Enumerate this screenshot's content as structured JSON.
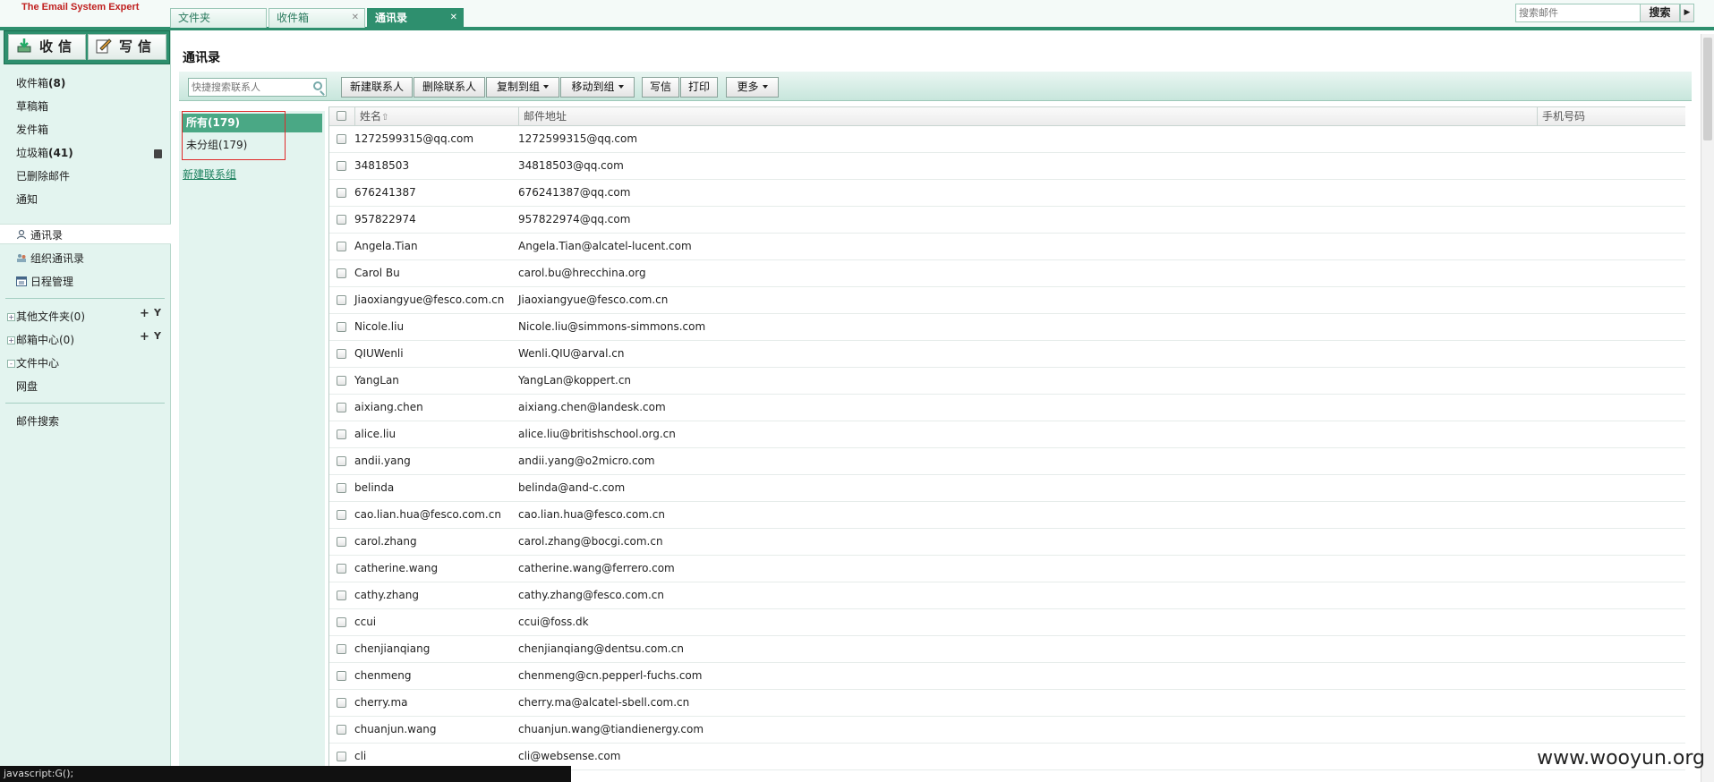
{
  "brand": "The Email System Expert",
  "tabs": [
    {
      "label": "文件夹",
      "closable": false,
      "active": false
    },
    {
      "label": "收件箱",
      "closable": true,
      "active": false
    },
    {
      "label": "通讯录",
      "closable": true,
      "active": true
    }
  ],
  "search": {
    "placeholder": "搜索邮件",
    "button": "搜索",
    "more": "▶"
  },
  "sidebar": {
    "receive": "收信",
    "compose": "写信",
    "folders": [
      {
        "label": "收件箱",
        "count": "(8)"
      },
      {
        "label": "草稿箱",
        "count": ""
      },
      {
        "label": "发件箱",
        "count": ""
      },
      {
        "label": "垃圾箱",
        "count": "(41)"
      },
      {
        "label": "已删除邮件",
        "count": ""
      },
      {
        "label": "通知",
        "count": ""
      }
    ],
    "apps": [
      {
        "label": "通讯录",
        "icon": "person-icon",
        "selected": true
      },
      {
        "label": "组织通讯录",
        "icon": "org-icon",
        "selected": false
      },
      {
        "label": "日程管理",
        "icon": "calendar-icon",
        "selected": false
      }
    ],
    "tree": [
      {
        "label": "其他文件夹(0)",
        "toggle": "+"
      },
      {
        "label": "邮箱中心(0)",
        "toggle": "+"
      },
      {
        "label": "文件中心",
        "toggle": "-"
      }
    ],
    "netdisk": "网盘",
    "mail_search": "邮件搜索"
  },
  "main": {
    "title": "通讯录",
    "contact_search_placeholder": "快捷搜索联系人",
    "toolbar": [
      {
        "label": "新建联系人",
        "dropdown": false
      },
      {
        "label": "删除联系人",
        "dropdown": false
      },
      {
        "label": "复制到组",
        "dropdown": true
      },
      {
        "label": "移动到组",
        "dropdown": true
      },
      {
        "label": "写信",
        "dropdown": false
      },
      {
        "label": "打印",
        "dropdown": false
      },
      {
        "label": "更多",
        "dropdown": true
      }
    ],
    "groups": [
      {
        "label": "所有",
        "count": "(179)",
        "selected": true
      },
      {
        "label": "未分组",
        "count": "(179)",
        "selected": false
      }
    ],
    "new_group": "新建联系组",
    "columns": {
      "name": "姓名",
      "sort_indicator": "⇧",
      "email": "邮件地址",
      "phone": "手机号码"
    },
    "contacts": [
      {
        "name": "1272599315@qq.com",
        "email": "1272599315@qq.com"
      },
      {
        "name": "34818503",
        "email": "34818503@qq.com"
      },
      {
        "name": "676241387",
        "email": "676241387@qq.com"
      },
      {
        "name": "957822974",
        "email": "957822974@qq.com"
      },
      {
        "name": "Angela.Tian",
        "email": "Angela.Tian@alcatel-lucent.com"
      },
      {
        "name": "Carol Bu",
        "email": "carol.bu@hrecchina.org"
      },
      {
        "name": "Jiaoxiangyue@fesco.com.cn",
        "email": "Jiaoxiangyue@fesco.com.cn"
      },
      {
        "name": "Nicole.liu",
        "email": "Nicole.liu@simmons-simmons.com"
      },
      {
        "name": "QIUWenli",
        "email": "Wenli.QIU@arval.cn"
      },
      {
        "name": "YangLan",
        "email": "YangLan@koppert.cn"
      },
      {
        "name": "aixiang.chen",
        "email": "aixiang.chen@landesk.com"
      },
      {
        "name": "alice.liu",
        "email": "alice.liu@britishschool.org.cn"
      },
      {
        "name": "andii.yang",
        "email": "andii.yang@o2micro.com"
      },
      {
        "name": "belinda",
        "email": "belinda@and-c.com"
      },
      {
        "name": "cao.lian.hua@fesco.com.cn",
        "email": "cao.lian.hua@fesco.com.cn"
      },
      {
        "name": "carol.zhang",
        "email": "carol.zhang@bocgi.com.cn"
      },
      {
        "name": "catherine.wang",
        "email": "catherine.wang@ferrero.com"
      },
      {
        "name": "cathy.zhang",
        "email": "cathy.zhang@fesco.com.cn"
      },
      {
        "name": "ccui",
        "email": "ccui@foss.dk"
      },
      {
        "name": "chenjianqiang",
        "email": "chenjianqiang@dentsu.com.cn"
      },
      {
        "name": "chenmeng",
        "email": "chenmeng@cn.pepperl-fuchs.com"
      },
      {
        "name": "cherry.ma",
        "email": "cherry.ma@alcatel-sbell.com.cn"
      },
      {
        "name": "chuanjun.wang",
        "email": "chuanjun.wang@tiandienergy.com"
      },
      {
        "name": "cli",
        "email": "cli@websense.com"
      }
    ]
  },
  "status": "javascript:G();",
  "watermark": "www.wooyun.org",
  "colors": {
    "accent": "#2e8f6e",
    "sidebar_bg": "#e3f4ef",
    "brand_red": "#c0201f",
    "highlight_red": "#e02a2a"
  }
}
